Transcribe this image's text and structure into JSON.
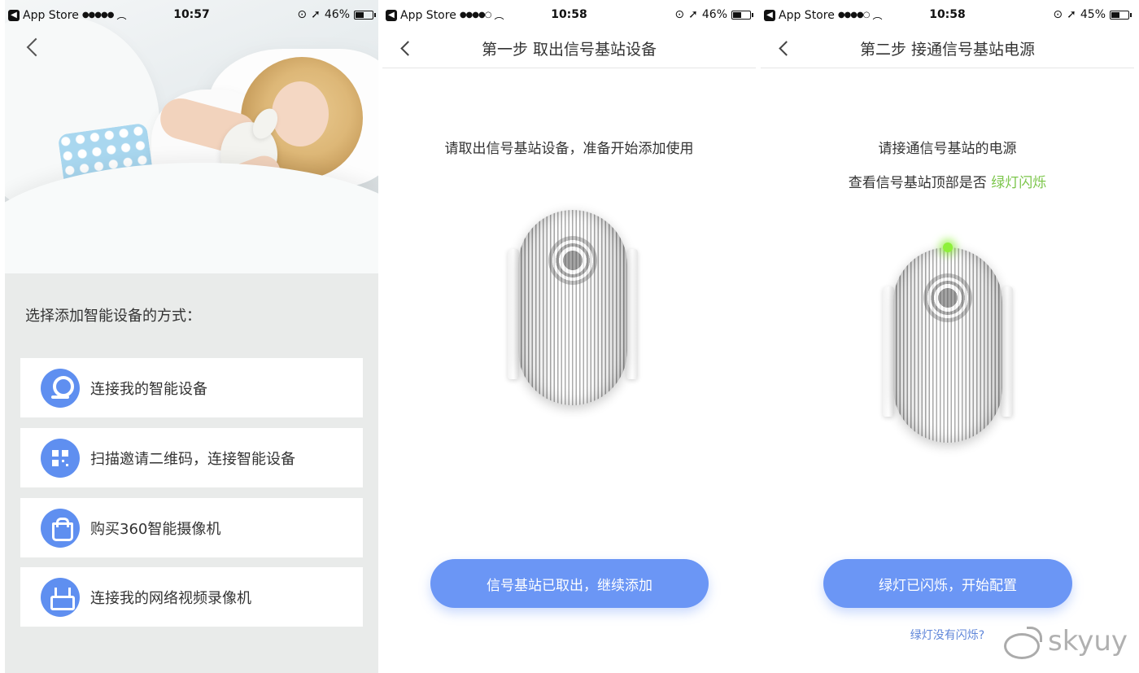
{
  "screens": [
    {
      "status": {
        "app": "App Store",
        "signal": "●●●●●",
        "time": "10:57",
        "battery": "46%",
        "battery_level": 0.46
      },
      "heading": "选择添加智能设备的方式：",
      "options": [
        {
          "label": "连接我的智能设备",
          "icon": "camera-icon"
        },
        {
          "label": "扫描邀请二维码，连接智能设备",
          "icon": "qr-code-icon"
        },
        {
          "label": "购买360智能摄像机",
          "icon": "shopping-bag-icon"
        },
        {
          "label": "连接我的网络视频录像机",
          "icon": "nvr-router-icon"
        }
      ]
    },
    {
      "status": {
        "app": "App Store",
        "signal": "●●●●○",
        "time": "10:58",
        "battery": "46%",
        "battery_level": 0.46
      },
      "title": "第一步 取出信号基站设备",
      "instruction": "请取出信号基站设备，准备开始添加使用",
      "button": "信号基站已取出，继续添加"
    },
    {
      "status": {
        "app": "App Store",
        "signal": "●●●●○",
        "time": "10:58",
        "battery": "45%",
        "battery_level": 0.45
      },
      "title": "第二步 接通信号基站电源",
      "instruction_line1": "请接通信号基站的电源",
      "instruction_line2_prefix": "查看信号基站顶部是否 ",
      "instruction_line2_highlight": "绿灯闪烁",
      "button": "绿灯已闪烁，开始配置",
      "help_link": "绿灯没有闪烁?"
    }
  ],
  "watermark": "skyuy",
  "colors": {
    "accent": "#6b96f5",
    "icon_bg": "#5f8ff0",
    "highlight_green": "#7cc64b",
    "link": "#5f86d9"
  }
}
